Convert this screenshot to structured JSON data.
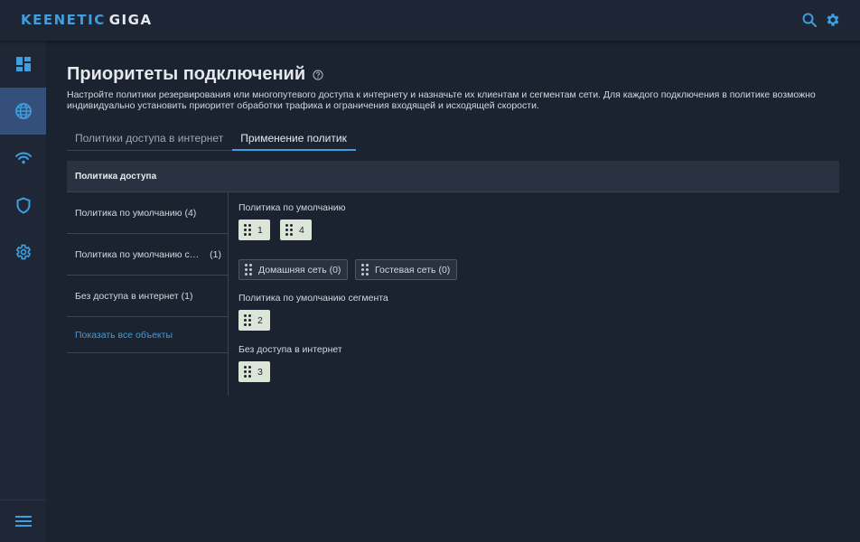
{
  "app": {
    "brand": "KEENETIC",
    "model": "GIGA"
  },
  "topbar": {
    "search_icon": "search-icon",
    "settings_icon": "gear-icon"
  },
  "sidebar": {
    "items": [
      {
        "icon": "dashboard-icon"
      },
      {
        "icon": "globe-icon",
        "active": true
      },
      {
        "icon": "wifi-icon"
      },
      {
        "icon": "shield-icon"
      },
      {
        "icon": "gear-icon"
      }
    ],
    "menu_icon": "hamburger-icon"
  },
  "page": {
    "title": "Приоритеты подключений",
    "description": "Настройте политики резервирования или многопутевого доступа к интернету и назначьте их клиентам и сегментам сети. Для каждого подключения в политике возможно индивидуально установить приоритет обработки трафика и ограничения входящей и исходящей скорости."
  },
  "tabs": [
    {
      "label": "Политики доступа в интернет",
      "active": false
    },
    {
      "label": "Применение политик",
      "active": true
    }
  ],
  "table": {
    "header": "Политика доступа"
  },
  "policies": [
    {
      "label": "Политика по умолчанию (4)",
      "count": ""
    },
    {
      "label": "Политика по умолчанию сег…",
      "count": "(1)"
    },
    {
      "label": "Без доступа в интернет (1)",
      "count": ""
    }
  ],
  "show_all": "Показать все объекты",
  "groups": [
    {
      "label": "Политика по умолчанию",
      "chips": [
        "1",
        "4"
      ],
      "segments": [
        "Домашняя сеть (0)",
        "Гостевая сеть (0)"
      ]
    },
    {
      "label": "Политика по умолчанию сегмента",
      "chips": [
        "2"
      ]
    },
    {
      "label": "Без доступа в интернет",
      "chips": [
        "3"
      ]
    }
  ],
  "colors": {
    "accent": "#3d9ee0",
    "background": "#1b2230",
    "chip": "#dde5d9",
    "active_sidebar": "#34507a"
  }
}
